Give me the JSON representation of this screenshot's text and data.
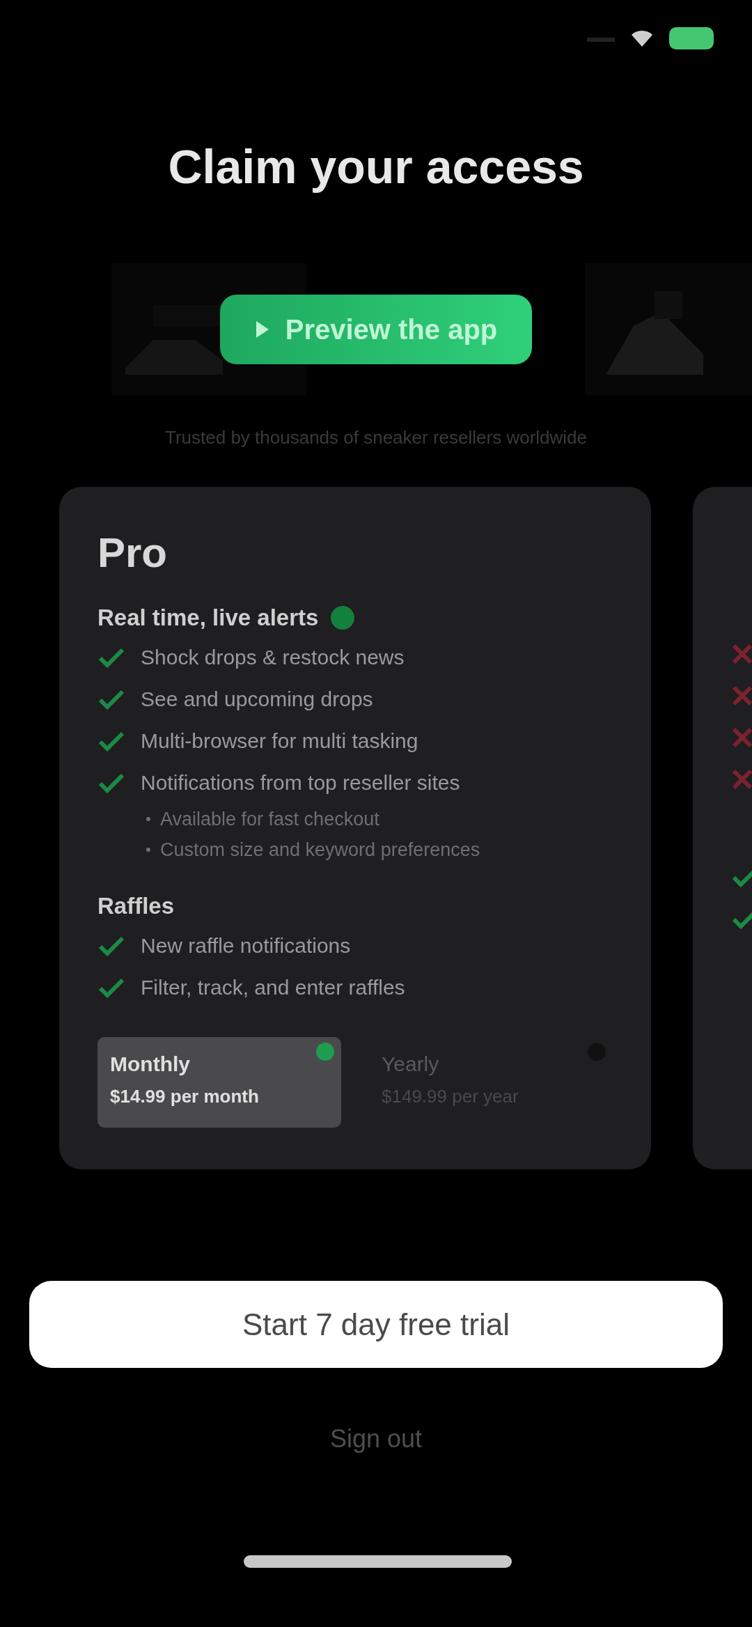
{
  "title": "Claim your access",
  "preview": {
    "button": "Preview the app",
    "caption": "Trusted by thousands of sneaker resellers worldwide"
  },
  "plans": [
    {
      "name": "Pro",
      "sections": [
        {
          "heading": "Real time, live alerts",
          "badge": true,
          "features": [
            {
              "text": "Shock drops & restock news",
              "included": true
            },
            {
              "text": "See and upcoming drops",
              "included": true
            },
            {
              "text": "Multi-browser for multi tasking",
              "included": true
            },
            {
              "text": "Notifications from top reseller sites",
              "included": true,
              "children": [
                {
                  "text": "Available for fast checkout"
                },
                {
                  "text": "Custom size and keyword preferences"
                }
              ]
            }
          ]
        },
        {
          "heading": "Raffles",
          "features": [
            {
              "text": "New raffle notifications",
              "included": true
            },
            {
              "text": "Filter, track, and enter raffles",
              "included": true
            }
          ]
        }
      ],
      "options": [
        {
          "period": "Monthly",
          "price": "$14.99 per month",
          "selected": true
        },
        {
          "period": "Yearly",
          "price": "$149.99 per year",
          "selected": false
        }
      ]
    },
    {
      "sections": [
        {
          "features": [
            {
              "included": false
            },
            {
              "included": false
            },
            {
              "included": false
            },
            {
              "included": false
            }
          ]
        },
        {
          "features": [
            {
              "included": true
            },
            {
              "included": true
            }
          ]
        }
      ]
    }
  ],
  "cta": "Start 7 day free trial",
  "sign_out": "Sign out"
}
